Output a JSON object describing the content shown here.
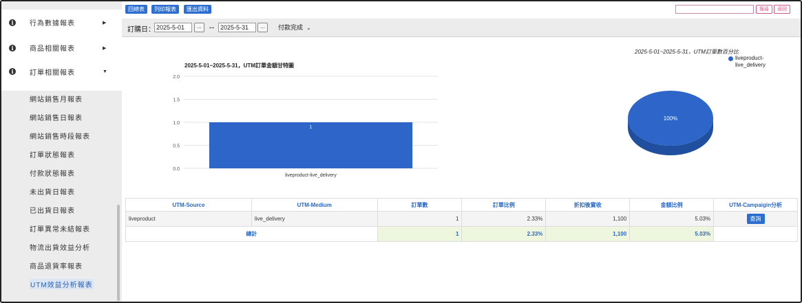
{
  "sidebar": {
    "groups": [
      {
        "label": "行為數據報表",
        "arrow": "▶"
      },
      {
        "label": "商品相關報表",
        "arrow": "▶"
      },
      {
        "label": "訂單相關報表",
        "arrow": "▼"
      }
    ],
    "items": [
      {
        "label": "網站銷售月報表"
      },
      {
        "label": "網站銷售日報表"
      },
      {
        "label": "網站銷售時段報表"
      },
      {
        "label": "訂單狀態報表"
      },
      {
        "label": "付款狀態報表"
      },
      {
        "label": "未出貨日報表"
      },
      {
        "label": "已出貨日報表"
      },
      {
        "label": "訂單異常未結報表"
      },
      {
        "label": "物流出貨效益分析"
      },
      {
        "label": "商品退貨率報表"
      },
      {
        "label": "UTM效益分析報表"
      }
    ]
  },
  "toolbar": {
    "buttons": [
      "回總表",
      "列印報表",
      "匯出資料"
    ],
    "search_value": "",
    "search_button": "搜尋",
    "back_button": "返回"
  },
  "filter": {
    "label": "訂購日：",
    "start_date": "2025-5-01",
    "end_date": "2025-5-31",
    "picker": "...",
    "between": "↔",
    "status": "付款完成"
  },
  "chart_data": [
    {
      "type": "bar",
      "title": "2025-5-01~2025-5-31，UTM訂單金額甘特圖",
      "categories": [
        "liveproduct-live_delivery"
      ],
      "values": [
        1
      ],
      "data_labels": [
        "1"
      ],
      "yticks": [
        "0.0",
        "0.5",
        "1.0",
        "1.5",
        "2.0"
      ],
      "ylim": [
        0,
        2
      ],
      "grid": true,
      "color": "#2d66c8"
    },
    {
      "type": "pie",
      "title": "2025-5-01~2025-5-31，UTM訂單數百分比",
      "slices": [
        {
          "label": "liveproduct-live_delivery",
          "value": 100,
          "display": "100%"
        }
      ],
      "legend": "top-right",
      "color": "#2d66c8"
    }
  ],
  "table": {
    "headers": [
      "UTM-Source",
      "UTM-Medium",
      "訂單數",
      "訂單比例",
      "折扣後實收",
      "金額比例",
      "UTM-Campaigin分析"
    ],
    "rows": [
      {
        "source": "liveproduct",
        "medium": "live_delivery",
        "orders": "1",
        "order_ratio": "2.33%",
        "net": "1,100",
        "amount_ratio": "5.03%",
        "action": "查詢"
      }
    ],
    "total": {
      "label": "總計",
      "orders": "1",
      "order_ratio": "2.33%",
      "net": "1,100",
      "amount_ratio": "5.03%"
    }
  }
}
